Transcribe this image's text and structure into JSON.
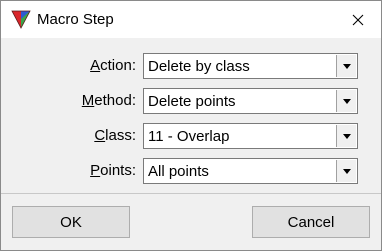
{
  "window": {
    "title": "Macro Step",
    "close_icon": "close-icon",
    "app_icon": "terrasolid-triangle-icon"
  },
  "form": {
    "action": {
      "label": "Action:",
      "mnemonic": "A",
      "rest": "ction:",
      "value": "Delete by class"
    },
    "method": {
      "label": "Method:",
      "mnemonic": "M",
      "rest": "ethod:",
      "value": "Delete points"
    },
    "class": {
      "label": "Class:",
      "mnemonic": "C",
      "rest": "lass:",
      "value": "11 - Overlap"
    },
    "points": {
      "label": "Points:",
      "mnemonic": "P",
      "rest": "oints:",
      "value": "All points"
    }
  },
  "buttons": {
    "ok": "OK",
    "cancel": "Cancel"
  },
  "colors": {
    "dialog_bg": "#f0f0f0",
    "titlebar_bg": "#ffffff",
    "button_bg": "#e1e1e1",
    "icon_red": "#d9262b",
    "icon_green": "#3aa64a",
    "icon_blue": "#2d5bd1"
  }
}
